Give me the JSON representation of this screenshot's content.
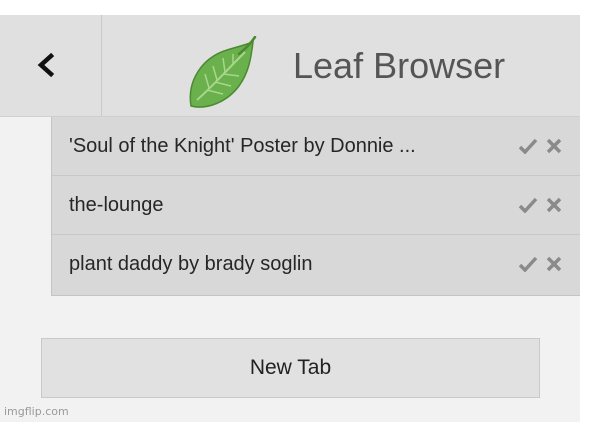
{
  "header": {
    "back_icon": "chevron-left-icon",
    "logo_icon": "leaf-icon",
    "title": "Leaf Browser"
  },
  "tabs": [
    {
      "title": "'Soul of the Knight' Poster by Donnie ...",
      "confirm_icon": "check-icon",
      "close_icon": "close-icon"
    },
    {
      "title": "the-lounge",
      "confirm_icon": "check-icon",
      "close_icon": "close-icon"
    },
    {
      "title": "plant daddy by brady soglin",
      "confirm_icon": "check-icon",
      "close_icon": "close-icon"
    }
  ],
  "new_tab_label": "New Tab",
  "watermark": "imgflip.com",
  "colors": {
    "header_bg": "#e0e0e0",
    "leaf_green": "#6ab04c",
    "icon_gray": "#8a8a8a"
  }
}
